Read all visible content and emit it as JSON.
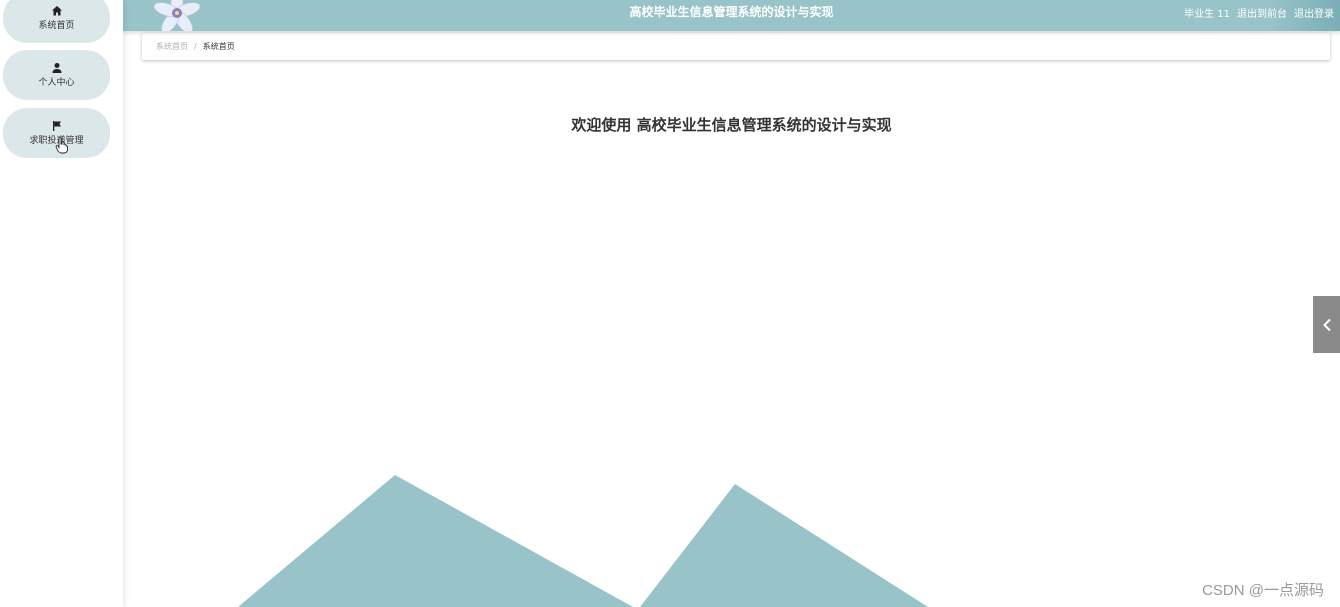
{
  "header": {
    "title": "高校毕业生信息管理系统的设计与实现",
    "user": "毕业生 11",
    "back_to_front": "退出到前台",
    "logout": "退出登录"
  },
  "sidebar": {
    "items": [
      {
        "label": "系统首页",
        "icon": "home-icon"
      },
      {
        "label": "个人中心",
        "icon": "user-icon"
      },
      {
        "label": "求职投递管理",
        "icon": "flag-icon"
      }
    ]
  },
  "breadcrumb": {
    "home": "系统首页",
    "separator": "/",
    "current": "系统首页"
  },
  "main": {
    "welcome": "欢迎使用 高校毕业生信息管理系统的设计与实现"
  },
  "watermark": "CSDN @一点源码",
  "colors": {
    "accent": "#98c3c8",
    "sidebar_item_bg": "#dbe7e9",
    "toggle_bg": "#8a8a8a"
  }
}
